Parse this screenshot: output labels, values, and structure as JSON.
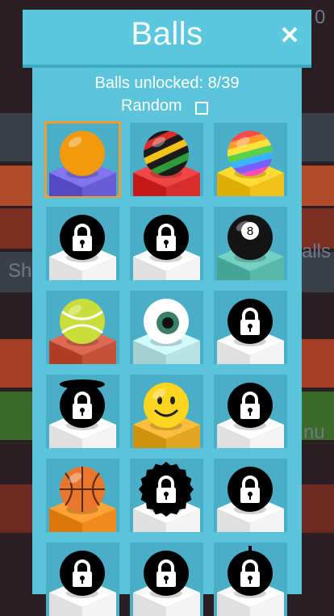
{
  "header": {
    "title": "Balls"
  },
  "stats": {
    "unlocked_text": "Balls unlocked: 8/39"
  },
  "options": {
    "random_label": "Random",
    "random_checked": false
  },
  "background_hints": [
    {
      "text": "Sh"
    },
    {
      "text": "alls"
    },
    {
      "text": "nu"
    },
    {
      "text": "0"
    }
  ],
  "balls": [
    {
      "name": "orange-ball",
      "locked": false,
      "selected": true,
      "ball": "#f29a0c",
      "base": "#6a5cd6"
    },
    {
      "name": "rasta-ball",
      "locked": false,
      "selected": false,
      "ball": "#1b1b1b",
      "base": "#d92d2d"
    },
    {
      "name": "rainbow-ball",
      "locked": false,
      "selected": false,
      "ball": "#ff4b4b",
      "base": "#f2c21b"
    },
    {
      "name": "locked-ball",
      "locked": true,
      "selected": false,
      "ball": "#000000",
      "base": "#f4f4f4"
    },
    {
      "name": "locked-ball",
      "locked": true,
      "selected": false,
      "ball": "#000000",
      "base": "#f4f4f4"
    },
    {
      "name": "eight-ball",
      "locked": false,
      "selected": false,
      "ball": "#141414",
      "base": "#5ab7aa"
    },
    {
      "name": "tennis-ball",
      "locked": false,
      "selected": false,
      "ball": "#c9dd3b",
      "base": "#c6513a"
    },
    {
      "name": "eyeball",
      "locked": false,
      "selected": false,
      "ball": "#ffffff",
      "base": "#b9e2e4"
    },
    {
      "name": "locked-ball",
      "locked": true,
      "selected": false,
      "ball": "#000000",
      "base": "#f4f4f4"
    },
    {
      "name": "locked-hat-ball",
      "locked": true,
      "selected": false,
      "ball": "#000000",
      "base": "#f4f4f4"
    },
    {
      "name": "smiley-ball",
      "locked": false,
      "selected": false,
      "ball": "#ffd51f",
      "base": "#e3a623"
    },
    {
      "name": "locked-ball",
      "locked": true,
      "selected": false,
      "ball": "#000000",
      "base": "#f4f4f4"
    },
    {
      "name": "basketball",
      "locked": false,
      "selected": false,
      "ball": "#e8762c",
      "base": "#f08a1d"
    },
    {
      "name": "locked-spiky-ball",
      "locked": true,
      "selected": false,
      "ball": "#000000",
      "base": "#f4f4f4"
    },
    {
      "name": "locked-ball",
      "locked": true,
      "selected": false,
      "ball": "#000000",
      "base": "#f4f4f4"
    },
    {
      "name": "locked-ball",
      "locked": true,
      "selected": false,
      "ball": "#000000",
      "base": "#f4f4f4"
    },
    {
      "name": "locked-ball",
      "locked": true,
      "selected": false,
      "ball": "#000000",
      "base": "#f4f4f4"
    },
    {
      "name": "locked-bomb-ball",
      "locked": true,
      "selected": false,
      "ball": "#000000",
      "base": "#f4f4f4"
    }
  ]
}
